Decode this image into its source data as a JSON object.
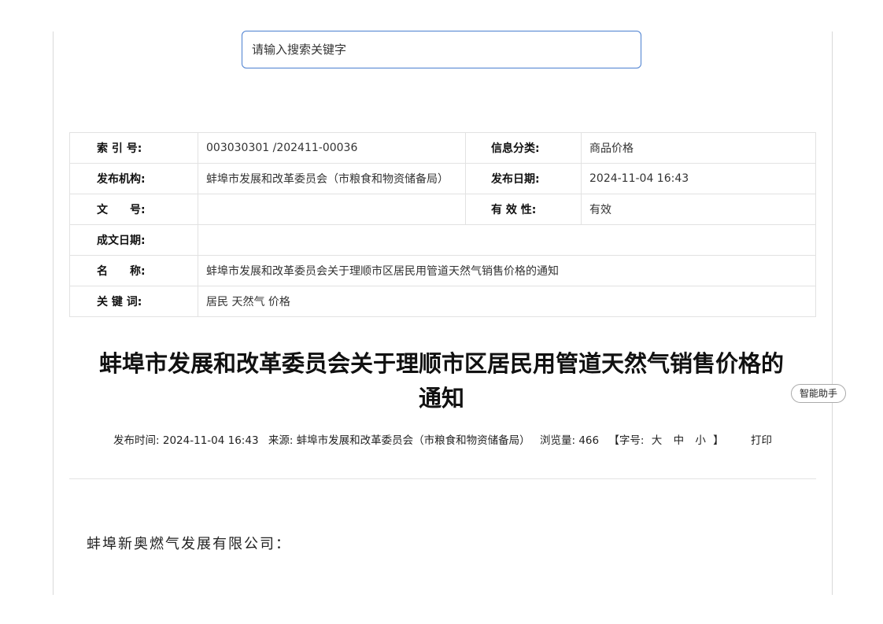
{
  "search": {
    "placeholder": "请输入搜索关键字"
  },
  "meta_table": {
    "index_no_label": "索 引 号:",
    "index_no_value": "003030301 /202411-00036",
    "category_label": "信息分类:",
    "category_value": "商品价格",
    "publisher_label": "发布机构:",
    "publisher_value": "蚌埠市发展和改革委员会（市粮食和物资储备局）",
    "pub_date_label": "发布日期:",
    "pub_date_value": "2024-11-04 16:43",
    "doc_no_label": "文　　号:",
    "doc_no_value": "",
    "validity_label": "有 效 性:",
    "validity_value": "有效",
    "written_date_label": "成文日期:",
    "written_date_value": "",
    "name_label": "名　　称:",
    "name_value": "蚌埠市发展和改革委员会关于理顺市区居民用管道天然气销售价格的通知",
    "keywords_label": "关 键 词:",
    "keywords_value": "居民 天然气 价格"
  },
  "article": {
    "title_line1": "蚌埠市发展和改革委员会关于理顺市区居民用管道天然气销售价格的",
    "title_line2": "通知",
    "salutation": "蚌埠新奥燃气发展有限公司："
  },
  "info_bar": {
    "time_label": "发布时间:",
    "time_value": "2024-11-04 16:43",
    "source_label": "来源:",
    "source_value": "蚌埠市发展和改革委员会（市粮食和物资储备局）",
    "views_label": "浏览量:",
    "views_value": "466",
    "font_size_prefix": "【字号:",
    "font_large": "大",
    "font_medium": "中",
    "font_small": "小",
    "font_size_suffix": "】",
    "print_label": "打印"
  },
  "assistant": {
    "label": "智能助手"
  }
}
